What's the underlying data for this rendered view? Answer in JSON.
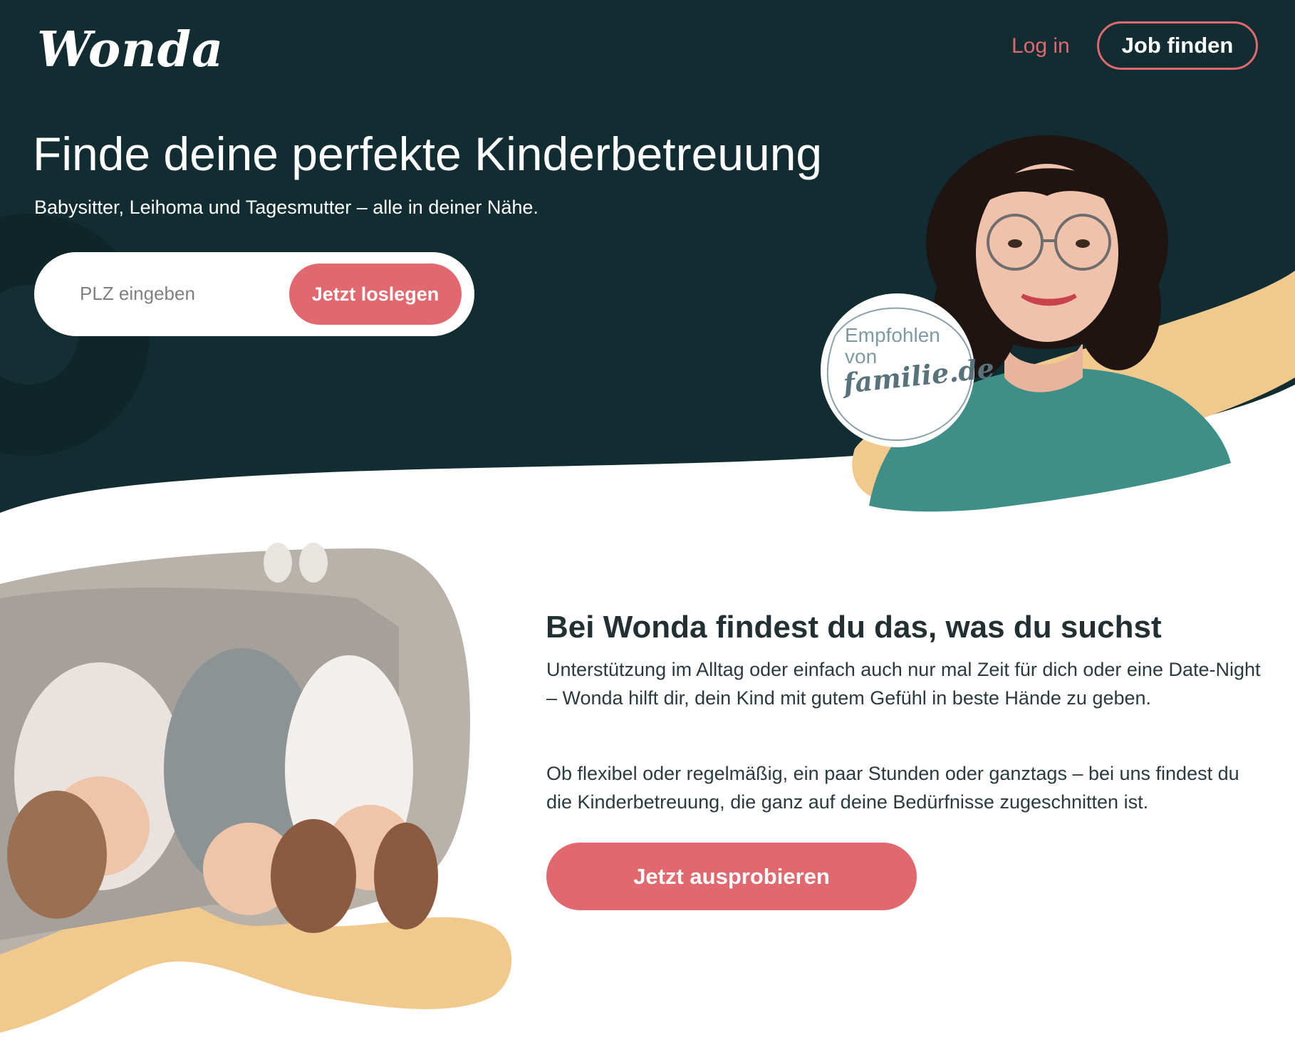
{
  "header": {
    "logo_text": "Wonda",
    "login_label": "Log in",
    "job_button_label": "Job finden"
  },
  "hero": {
    "title": "Finde deine perfekte Kinderbetreuung",
    "subtitle": "Babysitter, Leihoma und Tagesmutter – alle in deiner Nähe.",
    "search": {
      "placeholder": "PLZ eingeben",
      "value": "",
      "button_label": "Jetzt loslegen"
    },
    "badge": {
      "line1": "Empfohlen",
      "line2": "von",
      "brand": "familie.de"
    }
  },
  "section": {
    "title": "Bei Wonda findest du das, was du suchst",
    "paragraph1": "Unterstützung im Alltag oder einfach auch nur mal Zeit für dich oder eine Date-Night – Wonda hilft dir, dein Kind mit gutem Gefühl in beste Hände zu geben.",
    "paragraph2": "Ob flexibel oder regelmäßig, ein paar Stunden oder ganztags – bei uns findest du die Kinderbetreuung, die ganz auf deine Bedürfnisse zugeschnitten ist.",
    "cta_label": "Jetzt ausprobieren"
  },
  "colors": {
    "hero_background": "#122d31",
    "accent": "#e0686e",
    "yellow_swoosh": "#f2c98c",
    "text_dark": "#222f33"
  },
  "icons": {
    "portrait": "woman-portrait-photo",
    "kids": "three-children-photo"
  }
}
